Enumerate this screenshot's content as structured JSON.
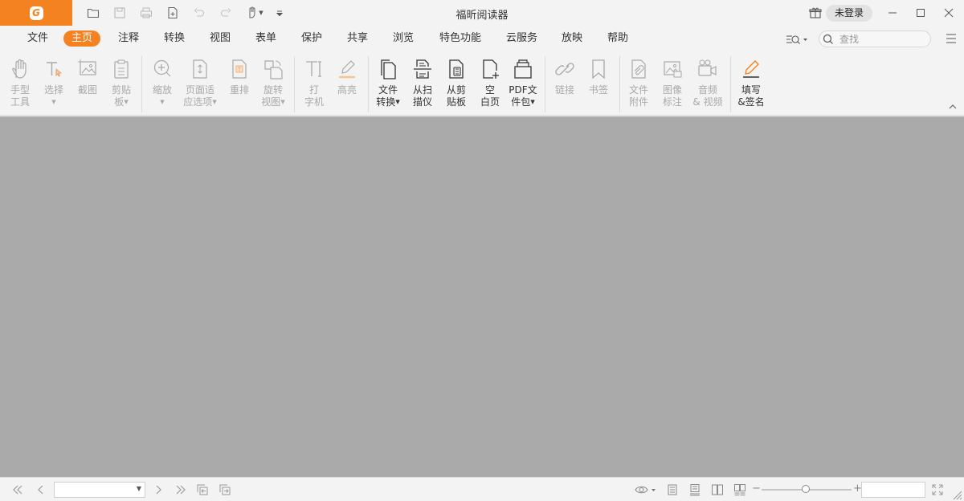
{
  "app": {
    "title": "福昕阅读器",
    "brand_color": "#f58220",
    "logo_letter": "G"
  },
  "quick_access": [
    "open-icon",
    "save-icon",
    "print-icon",
    "new-page-icon",
    "undo-icon",
    "redo-icon",
    "hand-icon",
    "customize-icon"
  ],
  "account": {
    "login_label": "未登录"
  },
  "menu": {
    "items": [
      "文件",
      "主页",
      "注释",
      "转换",
      "视图",
      "表单",
      "保护",
      "共享",
      "浏览",
      "特色功能",
      "云服务",
      "放映",
      "帮助"
    ],
    "active": "主页"
  },
  "search": {
    "placeholder": "查找"
  },
  "ribbon": {
    "hand": "手型\n工具",
    "select": "选择",
    "snapshot": "截图",
    "clipboard": "剪贴\n板",
    "zoom": "缩放",
    "fit_page": "页面适\n应选项",
    "reflow": "重排",
    "rotate": "旋转\n视图",
    "typewriter": "打\n字机",
    "highlight": "高亮",
    "convert": "文件\n转换",
    "scan": "从扫\n描仪",
    "from_clipboard": "从剪\n贴板",
    "blank": "空\n白页",
    "portfolio": "PDF文\n件包",
    "link": "链接",
    "bookmark": "书签",
    "attach": "文件\n附件",
    "image_annot": "图像\n标注",
    "audio_video": "音频\n& 视频",
    "fill_sign": "填写\n&签名"
  },
  "statusbar": {
    "page_value": "",
    "zoom_value": ""
  }
}
